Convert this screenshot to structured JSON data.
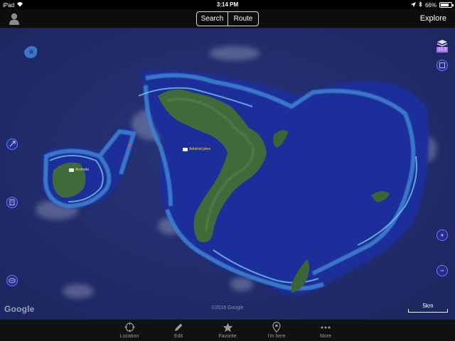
{
  "status_bar": {
    "device": "iPad",
    "time": "3:14 PM",
    "battery": "66%",
    "battery_level": 0.66
  },
  "nav_bar": {
    "search_label": "Search",
    "route_label": "Route",
    "explore_label": "Explore"
  },
  "map": {
    "pins": [
      {
        "label": "Artisinal piers"
      },
      {
        "label": "Aromata"
      }
    ],
    "zoom_badge": "12.3",
    "google_logo": "Google",
    "copyright": "©2016 Google",
    "scale_label": "5km",
    "colors": {
      "ocean": "#232e6b",
      "reef": "#3d7fd0",
      "land": "#3f6b3a",
      "button_accent": "#6a78ff"
    },
    "left_controls": [
      "compass-icon",
      "building-icon",
      "3d-icon"
    ],
    "right_controls": [
      "layers-icon",
      "map-type-icon",
      "zoom-in-icon",
      "zoom-out-icon"
    ]
  },
  "tab_bar": {
    "tabs": [
      {
        "label": "Location",
        "icon": "crosshair-icon"
      },
      {
        "label": "Edit",
        "icon": "pencil-icon"
      },
      {
        "label": "Favorite",
        "icon": "star-icon"
      },
      {
        "label": "I'm here",
        "icon": "map-pin-icon"
      },
      {
        "label": "More",
        "icon": "more-dots-icon"
      }
    ]
  }
}
